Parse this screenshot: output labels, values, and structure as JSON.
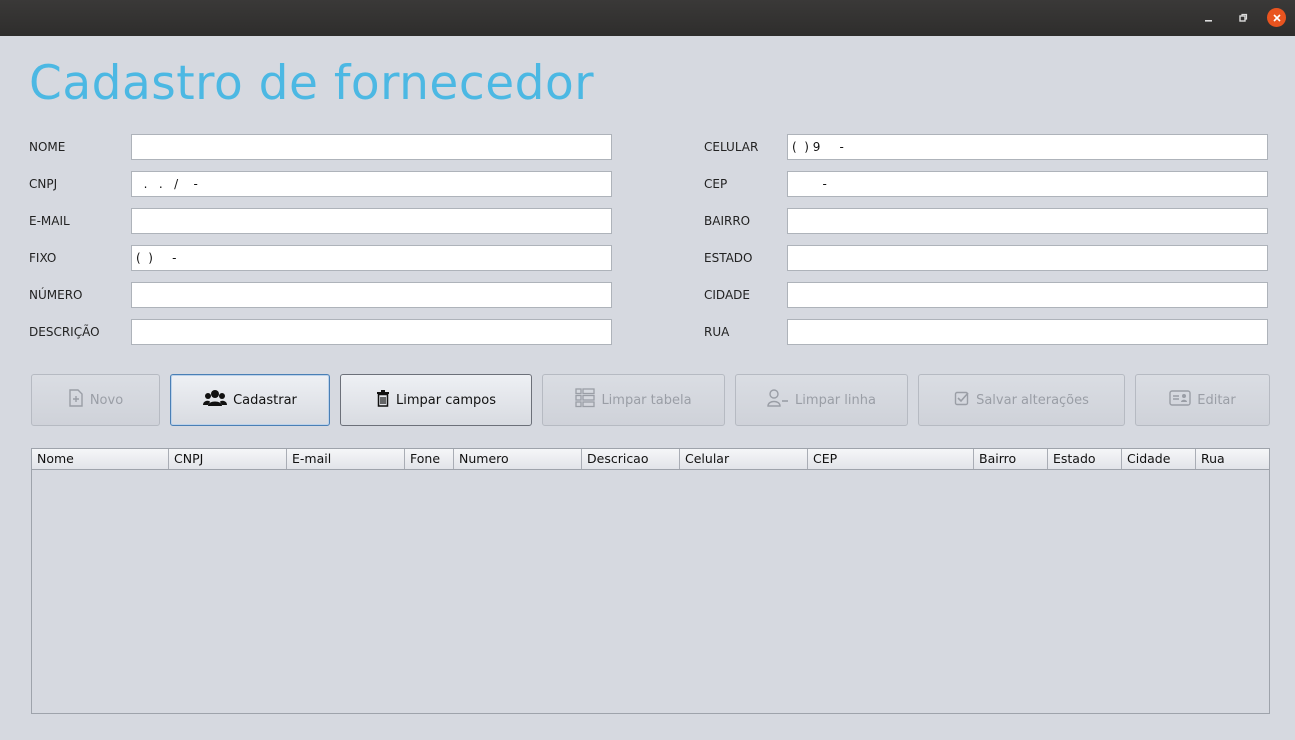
{
  "window": {
    "min_icon": "minimize-icon",
    "max_icon": "restore-icon",
    "close_icon": "close-icon"
  },
  "title": "Cadastro de fornecedor",
  "form": {
    "left": [
      {
        "label": "NOME",
        "value": ""
      },
      {
        "label": "CNPJ",
        "value": "  .   .   /    -"
      },
      {
        "label": "E-MAIL",
        "value": ""
      },
      {
        "label": "FIXO",
        "value": "(  )     -"
      },
      {
        "label": "NÚMERO",
        "value": ""
      },
      {
        "label": "DESCRIÇÃO",
        "value": ""
      }
    ],
    "right": [
      {
        "label": "CELULAR",
        "value": "(  ) 9     -"
      },
      {
        "label": "CEP",
        "value": "        -"
      },
      {
        "label": "BAIRRO",
        "value": ""
      },
      {
        "label": "ESTADO",
        "value": ""
      },
      {
        "label": "CIDADE",
        "value": ""
      },
      {
        "label": "RUA",
        "value": ""
      }
    ]
  },
  "buttons": {
    "novo": {
      "label": "Novo",
      "icon": "new-file-icon",
      "enabled": false
    },
    "cadastrar": {
      "label": "Cadastrar",
      "icon": "users-icon",
      "enabled": true
    },
    "limpar_campos": {
      "label": "Limpar campos",
      "icon": "trash-icon",
      "enabled": true
    },
    "limpar_tabela": {
      "label": "Limpar tabela",
      "icon": "table-list-icon",
      "enabled": false
    },
    "limpar_linha": {
      "label": "Limpar linha",
      "icon": "user-minus-icon",
      "enabled": false
    },
    "salvar": {
      "label": "Salvar alterações",
      "icon": "checkbox-icon",
      "enabled": false
    },
    "editar": {
      "label": "Editar",
      "icon": "id-card-icon",
      "enabled": false
    }
  },
  "table": {
    "columns": [
      "Nome",
      "CNPJ",
      "E-mail",
      "Fone",
      "Numero",
      "Descricao",
      "Celular",
      "CEP",
      "Bairro",
      "Estado",
      "Cidade",
      "Rua"
    ],
    "rows": []
  },
  "colors": {
    "title": "#4cb8e3",
    "background": "#d6d9e0",
    "close_button": "#e9541f"
  }
}
